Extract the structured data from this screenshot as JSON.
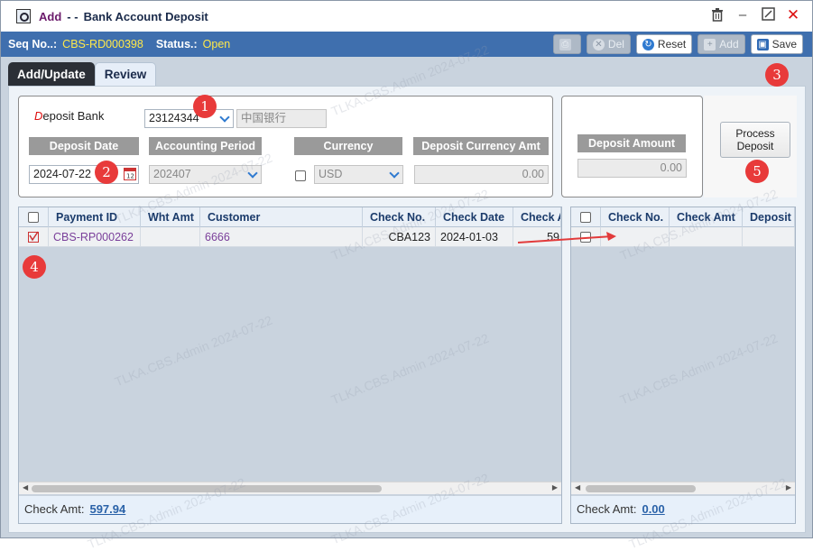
{
  "title": {
    "mode": "Add",
    "separator": "- -",
    "text": "Bank Account Deposit"
  },
  "info": {
    "seq_label": "Seq No..:",
    "seq_value": "CBS-RD000398",
    "status_label": "Status.:",
    "status_value": "Open"
  },
  "toolbar": {
    "print": "",
    "del": "Del",
    "reset": "Reset",
    "add": "Add",
    "save": "Save"
  },
  "tabs": [
    {
      "label": "Add/Update"
    },
    {
      "label": "Review"
    }
  ],
  "form": {
    "deposit_bank_label_first": "D",
    "deposit_bank_label_rest": "eposit Bank",
    "bank_code": "23124344",
    "bank_name": "中国银行",
    "deposit_date_label": "Deposit Date",
    "deposit_date": "2024-07-22",
    "accounting_period_label": "Accounting Period",
    "accounting_period": "202407",
    "currency_label": "Currency",
    "currency": "USD",
    "deposit_currency_amt_label": "Deposit Currency Amt",
    "deposit_currency_amt": "0.00",
    "deposit_amount_label": "Deposit Amount",
    "deposit_amount": "0.00",
    "process_button_line1": "Process",
    "process_button_line2": "Deposit"
  },
  "left_grid": {
    "columns": [
      "Payment ID",
      "Wht Amt",
      "Customer",
      "Check No.",
      "Check Date",
      "Check A"
    ],
    "rows": [
      {
        "payment_id": "CBS-RP000262",
        "wht_amt": "",
        "customer": "6666",
        "check_no": "CBA123",
        "check_date": "2024-01-03",
        "check_amt": "59"
      }
    ],
    "footer_label": "Check Amt:",
    "footer_value": "597.94"
  },
  "right_grid": {
    "columns": [
      "Check No.",
      "Check Amt",
      "Deposit I"
    ],
    "footer_label": "Check Amt:",
    "footer_value": "0.00"
  },
  "badges": [
    "1",
    "2",
    "3",
    "4",
    "5"
  ],
  "watermark": "TLKA.CBS.Admin 2024-07-22"
}
